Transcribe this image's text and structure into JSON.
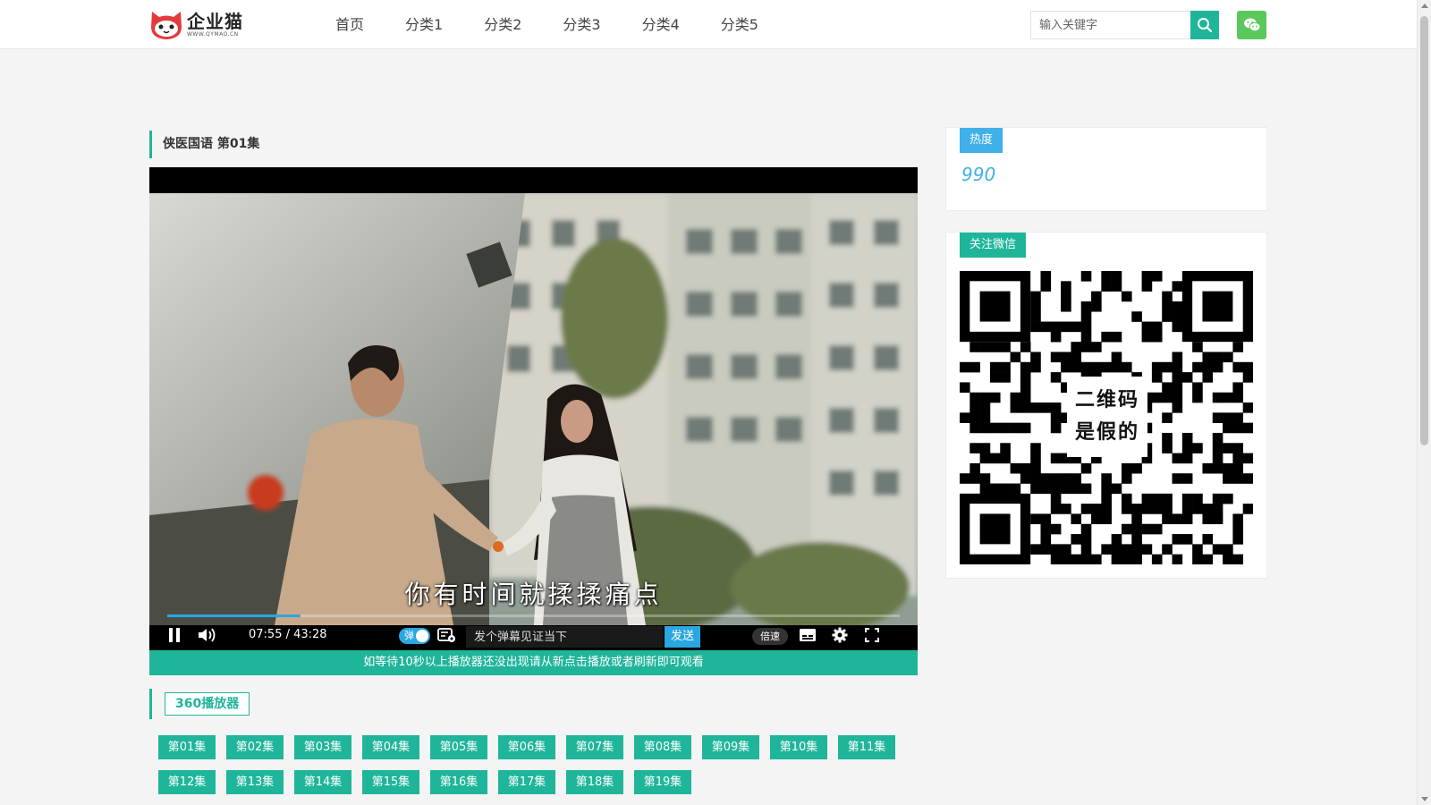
{
  "header": {
    "logo_name": "企业猫",
    "logo_sub": "WWW.QYMAO.CN",
    "nav": [
      "首页",
      "分类1",
      "分类2",
      "分类3",
      "分类4",
      "分类5"
    ],
    "search_placeholder": "输入关键字",
    "accent_color": "#1fb59a"
  },
  "main": {
    "title": "侠医国语 第01集",
    "player": {
      "subtitle": "你有时间就揉揉痛点",
      "time": "07:55 / 43:28",
      "progress_fraction": 0.182,
      "danmu_toggle_label": "弹",
      "danmu_placeholder": "发个弹幕见证当下",
      "send_label": "发送",
      "speed_label": "倍速"
    },
    "notice": "如等待10秒以上播放器还没出现请从新点击播放或者刷新即可观看",
    "source_label": "360播放器",
    "episodes": [
      "第01集",
      "第02集",
      "第03集",
      "第04集",
      "第05集",
      "第06集",
      "第07集",
      "第08集",
      "第09集",
      "第10集",
      "第11集",
      "第12集",
      "第13集",
      "第14集",
      "第15集",
      "第16集",
      "第17集",
      "第18集",
      "第19集"
    ]
  },
  "sidebar": {
    "hot_label": "热度",
    "hot_value": "990",
    "wechat_label": "关注微信",
    "qr_text_line1": "二维码",
    "qr_text_line2": "是假的"
  }
}
